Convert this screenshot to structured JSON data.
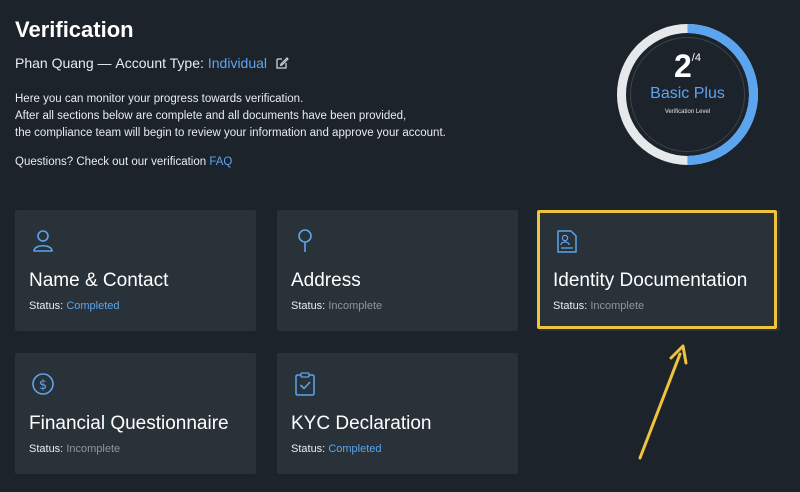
{
  "header": {
    "title": "Verification",
    "user_name": "Phan Quang",
    "account_type_label": "Account Type:",
    "account_type_value": "Individual",
    "intro_line1": "Here you can monitor your progress towards verification.",
    "intro_line2": "After all sections below are complete and all documents have been provided,",
    "intro_line3": "the compliance team will begin to review your information and approve your account.",
    "questions_prefix": "Questions? Check out our verification",
    "faq_link": "FAQ"
  },
  "level": {
    "current": "2",
    "total": "/4",
    "name": "Basic Plus",
    "caption": "Verification Level",
    "progress_fraction": 0.5,
    "accent": "#5ba4f0"
  },
  "status_label": "Status:",
  "cards": [
    {
      "title": "Name & Contact",
      "status": "Completed",
      "icon": "user-icon"
    },
    {
      "title": "Address",
      "status": "Incomplete",
      "icon": "location-pin-icon"
    },
    {
      "title": "Identity Documentation",
      "status": "Incomplete",
      "icon": "id-document-icon"
    },
    {
      "title": "Financial Questionnaire",
      "status": "Incomplete",
      "icon": "dollar-circle-icon"
    },
    {
      "title": "KYC Declaration",
      "status": "Completed",
      "icon": "clipboard-check-icon"
    }
  ],
  "colors": {
    "background": "#1c232a",
    "card": "#2a3239",
    "link": "#5ba4f0",
    "highlight": "#f0c33c"
  }
}
